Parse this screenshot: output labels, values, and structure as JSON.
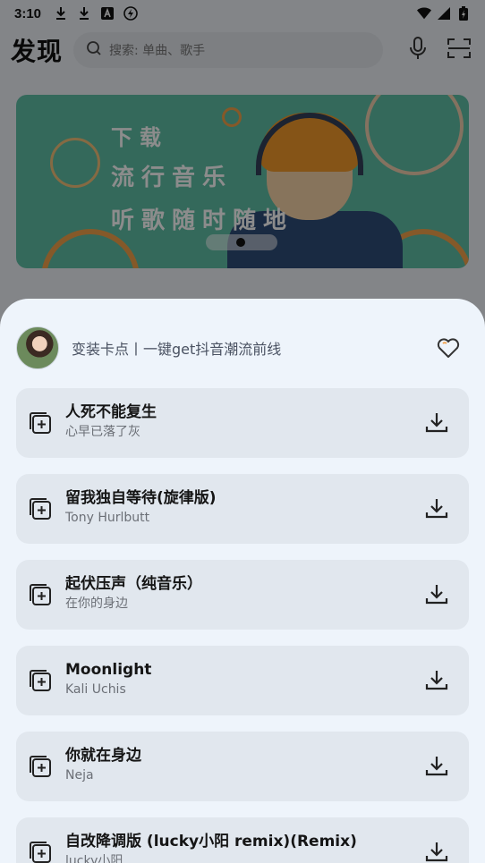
{
  "status_bar": {
    "time": "3:10",
    "left_icons": [
      "download-icon",
      "download-icon",
      "font-a-icon",
      "flash-icon"
    ],
    "right_icons": [
      "wifi-icon",
      "signal-icon",
      "battery-charging-icon"
    ]
  },
  "header": {
    "brand": "发现",
    "search_placeholder": "搜索: 单曲、歌手",
    "icons": [
      "mic-icon",
      "scan-icon"
    ]
  },
  "banner": {
    "line1": "下载",
    "line2": "流行音乐",
    "line3": "听歌随时随地"
  },
  "sheet": {
    "playlist_title": "变装卡点丨一键get抖音潮流前线",
    "songs": [
      {
        "title": "人死不能复生",
        "artist": "心早已落了灰"
      },
      {
        "title": "留我独自等待(旋律版)",
        "artist": "Tony Hurlbutt"
      },
      {
        "title": "起伏压声（纯音乐）",
        "artist": "在你的身边"
      },
      {
        "title": "Moonlight",
        "artist": "Kali Uchis"
      },
      {
        "title": "你就在身边",
        "artist": "Neja"
      },
      {
        "title": "自改降调版 (lucky小阳 remix)(Remix)",
        "artist": "lucky小阳"
      }
    ]
  },
  "colors": {
    "sheet_bg": "#eef4fb",
    "card_bg": "#e1e7ee",
    "banner_bg": "#5fbfa6",
    "accent_orange": "#f3a24b"
  }
}
